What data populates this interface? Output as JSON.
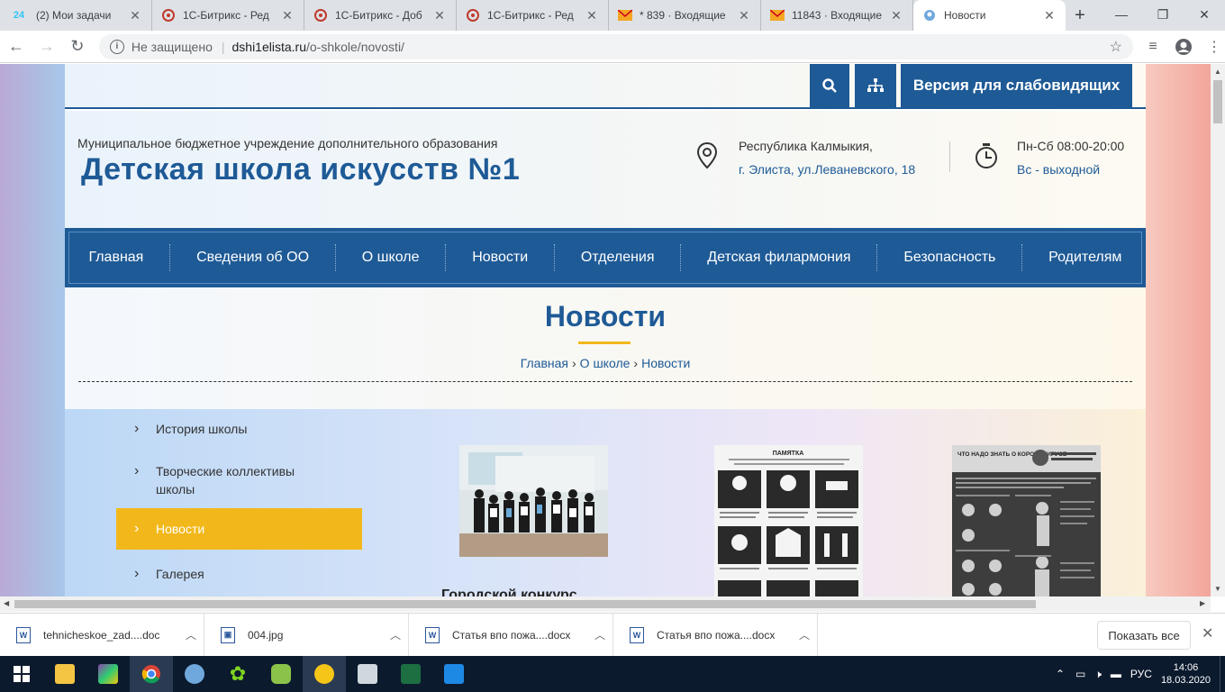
{
  "browser": {
    "tabs": [
      {
        "title": "(2) Мои задачи",
        "icon": "tasks-24-icon",
        "badge": "24"
      },
      {
        "title": "1С-Битрикс - Ред",
        "icon": "bitrix-icon"
      },
      {
        "title": "1С-Битрикс - Доб",
        "icon": "bitrix-icon"
      },
      {
        "title": "1С-Битрикс - Ред",
        "icon": "bitrix-icon"
      },
      {
        "title": "* 839 · Входящие",
        "icon": "mail-icon"
      },
      {
        "title": "11843 · Входящие",
        "icon": "mail-icon"
      },
      {
        "title": "Новости",
        "icon": "globe-icon",
        "active": true
      }
    ],
    "address": {
      "security": "Не защищено",
      "host": "dshi1elista.ru",
      "path": "/o-shkole/novosti/"
    }
  },
  "site": {
    "top_buttons": {
      "accessibility": "Версия для слабовидящих"
    },
    "org_subtitle": "Муниципальное бюджетное учреждение дополнительного образования",
    "org_name": "Детская школа искусств №1",
    "address": {
      "line1": "Республика Калмыкия,",
      "line2": "г. Элиста, ул.Леваневского, 18"
    },
    "hours": {
      "line1": "Пн-Сб 08:00-20:00",
      "line2": "Вс - выходной"
    },
    "nav": [
      "Главная",
      "Сведения об ОО",
      "О школе",
      "Новости",
      "Отделения",
      "Детская филармония",
      "Безопасность",
      "Родителям"
    ],
    "page_title": "Новости",
    "breadcrumb": [
      "Главная",
      "О школе",
      "Новости"
    ],
    "sidebar": [
      {
        "label": "История школы"
      },
      {
        "label": "Творческие коллективы школы"
      },
      {
        "label": "Новости",
        "active": true
      },
      {
        "label": "Галерея"
      }
    ],
    "cards": [
      {
        "title": "Городской конкурс",
        "image": "group-photo"
      },
      {
        "title": "",
        "image": "memo-poster",
        "poster_heading": "ПАМЯТКА"
      },
      {
        "title": "",
        "image": "coronavirus-poster",
        "poster_heading": "ЧТО НАДО ЗНАТЬ О КОРОНАВИРУСЕ"
      }
    ]
  },
  "downloads": [
    {
      "name": "tehnicheskoe_zad....doc",
      "type": "doc"
    },
    {
      "name": "004.jpg",
      "type": "jpg"
    },
    {
      "name": "Статья впо пожа....docx",
      "type": "doc"
    },
    {
      "name": "Статья впо пожа....docx",
      "type": "doc"
    }
  ],
  "downloads_show_all": "Показать все",
  "taskbar": {
    "lang": "РУС",
    "time": "14:06",
    "date": "18.03.2020"
  },
  "colors": {
    "brand": "#1e5a96",
    "accent": "#f2b81b"
  }
}
